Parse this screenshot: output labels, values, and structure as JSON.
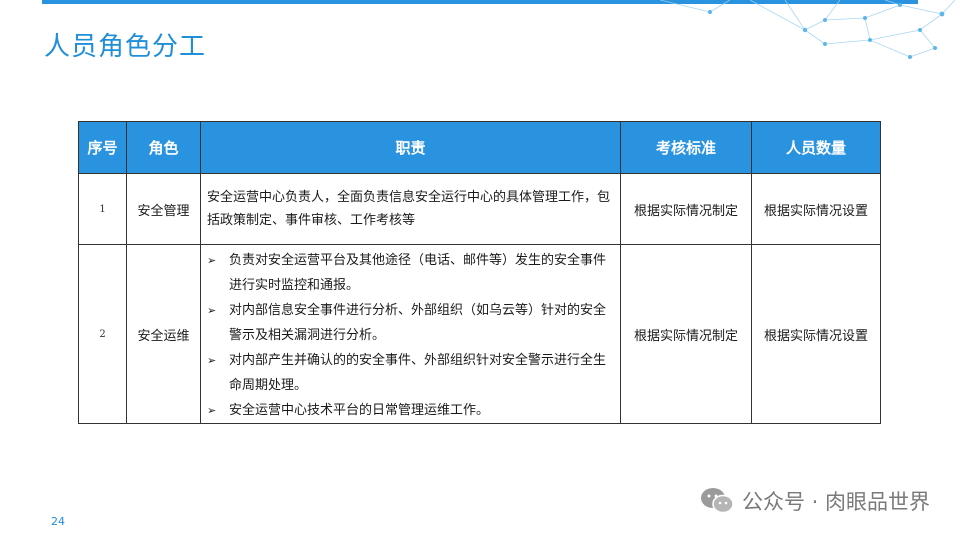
{
  "slide": {
    "title": "人员角色分工",
    "page_number": "24"
  },
  "table": {
    "headers": [
      "序号",
      "角色",
      "职责",
      "考核标准",
      "人员数量"
    ],
    "rows": [
      {
        "index": "1",
        "role": "安全管理",
        "duty_text": "安全运营中心负责人，全面负责信息安全运行中心的具体管理工作，包括政策制定、事件审核、工作考核等",
        "criteria": "根据实际情况制定",
        "headcount": "根据实际情况设置"
      },
      {
        "index": "2",
        "role": "安全运维",
        "duty_bullet": "➢",
        "duty_items": [
          "负责对安全运营平台及其他途径（电话、邮件等）发生的安全事件进行实时监控和通报。",
          "对内部信息安全事件进行分析、外部组织（如乌云等）针对的安全警示及相关漏洞进行分析。",
          "对内部产生并确认的的安全事件、外部组织针对安全警示进行全生命周期处理。",
          "安全运营中心技术平台的日常管理运维工作。"
        ],
        "criteria": "根据实际情况制定",
        "headcount": "根据实际情况设置"
      }
    ]
  },
  "watermark": {
    "text": "公众号 · 肉眼品世界",
    "icon": "wechat-icon"
  },
  "colors": {
    "accent": "#2a93df",
    "title": "#1f8fd8",
    "watermark": "#7a7a7a"
  }
}
